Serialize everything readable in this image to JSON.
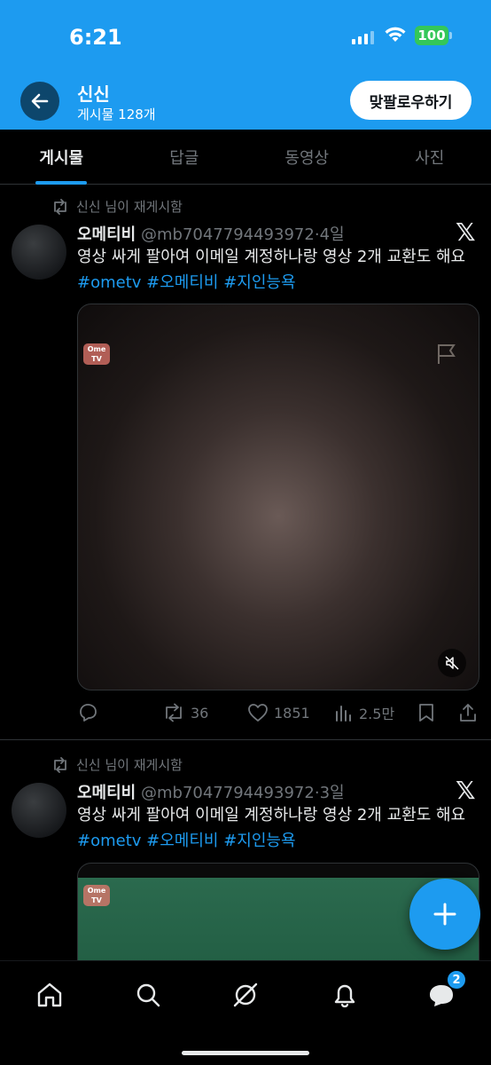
{
  "status_bar": {
    "time": "6:21",
    "battery": "100"
  },
  "header": {
    "name": "신신",
    "post_count": "게시물 128개",
    "follow_button": "맞팔로우하기"
  },
  "tabs": [
    {
      "label": "게시물",
      "active": true
    },
    {
      "label": "답글",
      "active": false
    },
    {
      "label": "동영상",
      "active": false
    },
    {
      "label": "사진",
      "active": false
    }
  ],
  "posts": [
    {
      "repost_label": "신신 님이 재게시함",
      "author_name": "오메티비",
      "handle": "@mb7047794493972",
      "separator": "·",
      "time": "4일",
      "text": "영상 싸게 팔아여 이메일 계정하나랑 영상 2개 교환도 해요",
      "hashtags": [
        "#ometv",
        "#오메티비",
        "#지인능욕"
      ],
      "media_badge": "Ome TV",
      "stats": {
        "retweets": "36",
        "likes": "1851",
        "views": "2.5만"
      }
    },
    {
      "repost_label": "신신 님이 재게시함",
      "author_name": "오메티비",
      "handle": "@mb7047794493972",
      "separator": "·",
      "time": "3일",
      "text": "영상 싸게 팔아여 이메일 계정하나랑 영상 2개 교환도 해요",
      "hashtags": [
        "#ometv",
        "#오메티비",
        "#지인능욕"
      ],
      "media_badge": "Ome TV"
    }
  ],
  "bottom_nav": {
    "notifications_badge": "2"
  },
  "colors": {
    "accent": "#1d9bf0",
    "background": "#000000",
    "muted": "#71767b",
    "battery": "#34c759"
  }
}
